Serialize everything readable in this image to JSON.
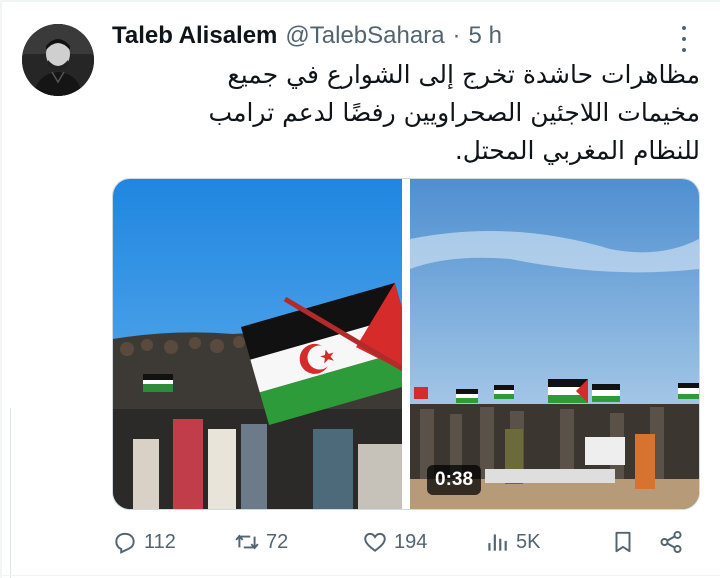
{
  "tweet": {
    "author_name": "Taleb Alisalem",
    "handle": "@TalebSahara",
    "separator": "·",
    "time": "5 h",
    "text": "مظاهرات حاشدة تخرج إلى الشوارع في جميع مخيمات اللاجئين الصحراويين رفضًا لدعم ترامب للنظام المغربي المحتل."
  },
  "media": {
    "video_duration": "0:38"
  },
  "actions": {
    "replies": "112",
    "retweets": "72",
    "likes": "194",
    "views": "5K"
  },
  "icons": {
    "more": "more-dots-icon",
    "reply": "reply-icon",
    "retweet": "retweet-icon",
    "like": "heart-icon",
    "views": "views-icon",
    "bookmark": "bookmark-icon",
    "share": "share-icon"
  },
  "colors": {
    "text": "#0f1419",
    "secondary": "#536471",
    "border": "#cfd9de"
  }
}
